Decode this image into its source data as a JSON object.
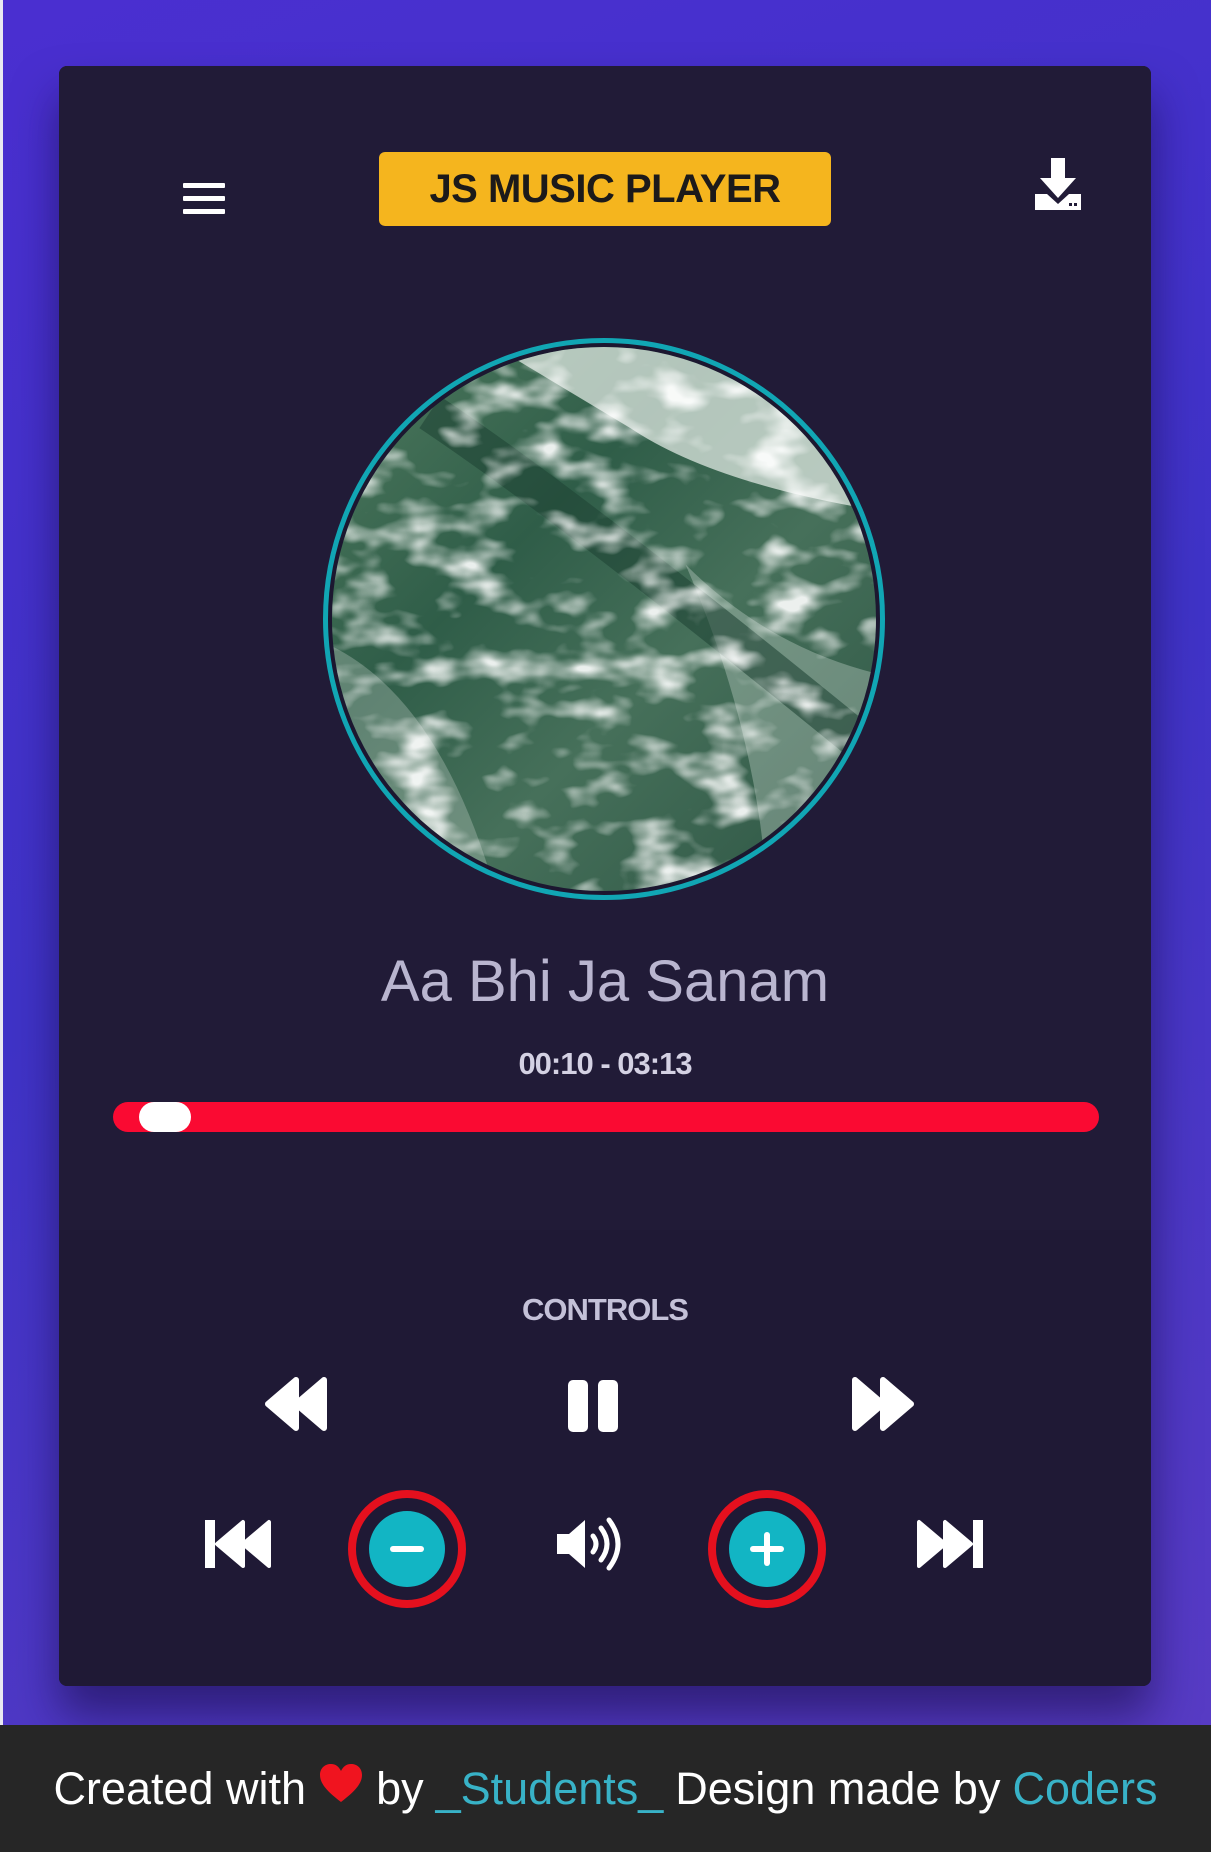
{
  "app": {
    "title": "JS MUSIC PLAYER"
  },
  "header": {
    "menu_icon": "hamburger-icon",
    "download_icon": "download-icon"
  },
  "track": {
    "title": "Aa Bhi Ja Sanam",
    "time_display": "00:10 - 03:13",
    "current_time": "00:10",
    "duration": "03:13",
    "progress_fraction": 0.053
  },
  "controls": {
    "label": "CONTROLS",
    "row1": [
      "rewind-icon",
      "pause-icon",
      "fast-forward-icon"
    ],
    "row2": [
      "skip-previous-icon",
      "volume-down-icon",
      "volume-icon",
      "volume-up-icon",
      "skip-next-icon"
    ]
  },
  "footer": {
    "created_with": "Created with",
    "by": "by",
    "author": "_Students_",
    "design_made_by": "Design made by",
    "designer": "Coders"
  },
  "colors": {
    "accent": "#f5b51e",
    "teal": "#12b5c4",
    "progress": "#fa0a32",
    "card": "#211b37",
    "highlight": "#e5101e"
  }
}
